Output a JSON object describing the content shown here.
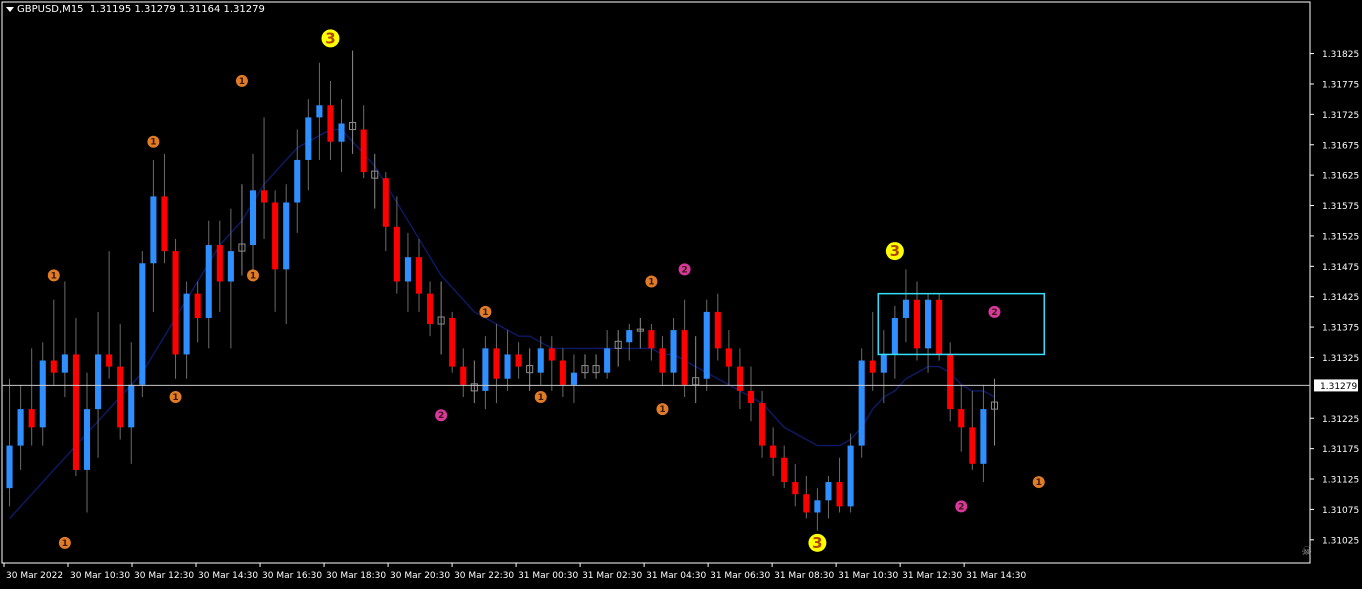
{
  "header": {
    "symbol": "GBPUSD,M15",
    "ohlc": "1.31195 1.31279 1.31164 1.31279"
  },
  "colors": {
    "background": "#000000",
    "bull": "#2f8fff",
    "bear": "#ff0000",
    "doji": "#8c8c8c",
    "ma": "#0d1a66",
    "box": "#33e0ff",
    "wave3": "#ffff00",
    "wave1": "#e07b28",
    "wave2": "#d9379e",
    "axis": "#ffffff",
    "priceline": "#c9c9c9"
  },
  "chart_data": {
    "type": "candlestick",
    "symbol": "GBPUSD",
    "timeframe": "M15",
    "ylim": [
      1.31,
      1.319
    ],
    "y_ticks": [
      "1.31825",
      "1.31775",
      "1.31725",
      "1.31675",
      "1.31625",
      "1.31575",
      "1.31525",
      "1.31475",
      "1.31425",
      "1.31375",
      "1.31325",
      "1.31279",
      "1.31225",
      "1.31175",
      "1.31125",
      "1.31075",
      "1.31025"
    ],
    "x_ticks": [
      "30 Mar 2022",
      "30 Mar 10:30",
      "30 Mar 12:30",
      "30 Mar 14:30",
      "30 Mar 16:30",
      "30 Mar 18:30",
      "30 Mar 20:30",
      "30 Mar 22:30",
      "31 Mar 00:30",
      "31 Mar 02:30",
      "31 Mar 04:30",
      "31 Mar 06:30",
      "31 Mar 08:30",
      "31 Mar 10:30",
      "31 Mar 12:30",
      "31 Mar 14:30"
    ],
    "last_price": "1.31279",
    "candles": [
      [
        1.3111,
        1.3129,
        1.3108,
        1.3118
      ],
      [
        1.3118,
        1.3128,
        1.3114,
        1.3124
      ],
      [
        1.3124,
        1.3134,
        1.3118,
        1.3121
      ],
      [
        1.3121,
        1.3135,
        1.3118,
        1.3132
      ],
      [
        1.3132,
        1.3142,
        1.3128,
        1.313
      ],
      [
        1.313,
        1.3145,
        1.3126,
        1.3133
      ],
      [
        1.3133,
        1.3139,
        1.3113,
        1.3114
      ],
      [
        1.3114,
        1.313,
        1.3107,
        1.3124
      ],
      [
        1.3124,
        1.314,
        1.3116,
        1.3133
      ],
      [
        1.3133,
        1.315,
        1.3129,
        1.3131
      ],
      [
        1.3131,
        1.3138,
        1.3119,
        1.3121
      ],
      [
        1.3121,
        1.3135,
        1.3115,
        1.3128
      ],
      [
        1.3128,
        1.315,
        1.3126,
        1.3148
      ],
      [
        1.3148,
        1.3165,
        1.314,
        1.3159
      ],
      [
        1.3159,
        1.3166,
        1.3148,
        1.315
      ],
      [
        1.315,
        1.3152,
        1.3129,
        1.3133
      ],
      [
        1.3133,
        1.3145,
        1.3129,
        1.3143
      ],
      [
        1.3143,
        1.3145,
        1.3135,
        1.3139
      ],
      [
        1.3139,
        1.3155,
        1.3134,
        1.3151
      ],
      [
        1.3151,
        1.3155,
        1.314,
        1.3145
      ],
      [
        1.3145,
        1.3157,
        1.3134,
        1.315
      ],
      [
        1.315,
        1.3161,
        1.3146,
        1.3151
      ],
      [
        1.3151,
        1.3166,
        1.3145,
        1.316
      ],
      [
        1.316,
        1.3172,
        1.3152,
        1.3158
      ],
      [
        1.3158,
        1.316,
        1.314,
        1.3147
      ],
      [
        1.3147,
        1.3161,
        1.3138,
        1.3158
      ],
      [
        1.3158,
        1.317,
        1.3153,
        1.3165
      ],
      [
        1.3165,
        1.3175,
        1.316,
        1.3172
      ],
      [
        1.3172,
        1.3181,
        1.3165,
        1.3174
      ],
      [
        1.3174,
        1.3178,
        1.3165,
        1.3168
      ],
      [
        1.3168,
        1.3175,
        1.3163,
        1.3171
      ],
      [
        1.3171,
        1.3183,
        1.3166,
        1.317
      ],
      [
        1.317,
        1.3174,
        1.3162,
        1.3163
      ],
      [
        1.3163,
        1.3166,
        1.3157,
        1.3162
      ],
      [
        1.3162,
        1.3163,
        1.315,
        1.3154
      ],
      [
        1.3154,
        1.3159,
        1.3143,
        1.3145
      ],
      [
        1.3145,
        1.3153,
        1.314,
        1.3149
      ],
      [
        1.3149,
        1.3152,
        1.314,
        1.3143
      ],
      [
        1.3143,
        1.3145,
        1.3136,
        1.3138
      ],
      [
        1.3138,
        1.3145,
        1.3133,
        1.3139
      ],
      [
        1.3139,
        1.314,
        1.313,
        1.3131
      ],
      [
        1.3131,
        1.3134,
        1.3126,
        1.3128
      ],
      [
        1.3128,
        1.3132,
        1.3125,
        1.3127
      ],
      [
        1.3127,
        1.3136,
        1.3124,
        1.3134
      ],
      [
        1.3134,
        1.3138,
        1.3125,
        1.3129
      ],
      [
        1.3129,
        1.3137,
        1.3127,
        1.3133
      ],
      [
        1.3133,
        1.3135,
        1.3129,
        1.3131
      ],
      [
        1.3131,
        1.3134,
        1.3127,
        1.313
      ],
      [
        1.313,
        1.3136,
        1.3128,
        1.3134
      ],
      [
        1.3134,
        1.3136,
        1.3127,
        1.3132
      ],
      [
        1.3132,
        1.3134,
        1.3126,
        1.3128
      ],
      [
        1.3128,
        1.3133,
        1.3125,
        1.313
      ],
      [
        1.313,
        1.3133,
        1.3129,
        1.3131
      ],
      [
        1.3131,
        1.3133,
        1.3129,
        1.313
      ],
      [
        1.313,
        1.3137,
        1.3129,
        1.3134
      ],
      [
        1.3134,
        1.3137,
        1.3131,
        1.3135
      ],
      [
        1.3135,
        1.3138,
        1.3132,
        1.3137
      ],
      [
        1.3137,
        1.3139,
        1.3134,
        1.3137
      ],
      [
        1.3137,
        1.3138,
        1.3132,
        1.3134
      ],
      [
        1.3134,
        1.3136,
        1.3128,
        1.313
      ],
      [
        1.313,
        1.3139,
        1.3128,
        1.3137
      ],
      [
        1.3137,
        1.3142,
        1.3126,
        1.3128
      ],
      [
        1.3128,
        1.3136,
        1.3125,
        1.3129
      ],
      [
        1.3129,
        1.3142,
        1.3127,
        1.314
      ],
      [
        1.314,
        1.3143,
        1.3132,
        1.3134
      ],
      [
        1.3134,
        1.3137,
        1.3128,
        1.3131
      ],
      [
        1.3131,
        1.3134,
        1.3124,
        1.3127
      ],
      [
        1.3127,
        1.3131,
        1.3122,
        1.3125
      ],
      [
        1.3125,
        1.3127,
        1.3116,
        1.3118
      ],
      [
        1.3118,
        1.3121,
        1.3113,
        1.3116
      ],
      [
        1.3116,
        1.3118,
        1.3111,
        1.3112
      ],
      [
        1.3112,
        1.3115,
        1.3108,
        1.311
      ],
      [
        1.311,
        1.3113,
        1.3106,
        1.3107
      ],
      [
        1.3107,
        1.3111,
        1.3104,
        1.3109
      ],
      [
        1.3109,
        1.3113,
        1.3106,
        1.3112
      ],
      [
        1.3112,
        1.3116,
        1.3107,
        1.3108
      ],
      [
        1.3108,
        1.312,
        1.3107,
        1.3118
      ],
      [
        1.3118,
        1.3134,
        1.3116,
        1.3132
      ],
      [
        1.3132,
        1.314,
        1.3127,
        1.313
      ],
      [
        1.313,
        1.3137,
        1.3125,
        1.3133
      ],
      [
        1.3133,
        1.3141,
        1.3129,
        1.3139
      ],
      [
        1.3139,
        1.3147,
        1.3135,
        1.3142
      ],
      [
        1.3142,
        1.3145,
        1.3132,
        1.3134
      ],
      [
        1.3134,
        1.3143,
        1.313,
        1.3142
      ],
      [
        1.3142,
        1.3143,
        1.3132,
        1.3133
      ],
      [
        1.3133,
        1.3135,
        1.3122,
        1.3124
      ],
      [
        1.3124,
        1.3128,
        1.3117,
        1.3121
      ],
      [
        1.3121,
        1.3127,
        1.3114,
        1.3115
      ],
      [
        1.3115,
        1.3128,
        1.3112,
        1.3124
      ],
      [
        1.3124,
        1.3129,
        1.3118,
        1.3125
      ]
    ],
    "ma": [
      1.3106,
      1.3108,
      1.311,
      1.3112,
      1.3114,
      1.3116,
      1.3118,
      1.312,
      1.3122,
      1.3124,
      1.3126,
      1.3128,
      1.313,
      1.3133,
      1.3136,
      1.3139,
      1.3142,
      1.3145,
      1.3148,
      1.3151,
      1.3153,
      1.3155,
      1.3158,
      1.3161,
      1.3163,
      1.3165,
      1.3167,
      1.3168,
      1.3169,
      1.317,
      1.317,
      1.3168,
      1.3166,
      1.3164,
      1.3161,
      1.3158,
      1.3155,
      1.3152,
      1.3149,
      1.3146,
      1.3144,
      1.3142,
      1.314,
      1.3139,
      1.3138,
      1.3137,
      1.3136,
      1.3136,
      1.3135,
      1.3134,
      1.3134,
      1.3134,
      1.3134,
      1.3134,
      1.3134,
      1.3134,
      1.3134,
      1.3134,
      1.3134,
      1.3133,
      1.3133,
      1.3132,
      1.3131,
      1.313,
      1.3129,
      1.3128,
      1.3127,
      1.3126,
      1.3125,
      1.3123,
      1.3121,
      1.312,
      1.3119,
      1.3118,
      1.3118,
      1.3118,
      1.3119,
      1.3121,
      1.3124,
      1.3126,
      1.3127,
      1.3129,
      1.313,
      1.3131,
      1.3131,
      1.313,
      1.3128,
      1.3127,
      1.3127,
      1.3126
    ],
    "box": {
      "start_index": 79,
      "end_index": 93,
      "high": 1.3143,
      "low": 1.3133
    },
    "wave_labels": [
      {
        "index": 29,
        "label": "3",
        "kind": "wave3",
        "price": 1.3185
      },
      {
        "index": 73,
        "label": "3",
        "kind": "wave3",
        "price": 1.3102
      },
      {
        "index": 80,
        "label": "3",
        "kind": "wave3",
        "price": 1.315
      },
      {
        "index": 4,
        "label": "1",
        "kind": "wave1",
        "price": 1.3146
      },
      {
        "index": 5,
        "label": "1",
        "kind": "wave1",
        "price": 1.3102
      },
      {
        "index": 13,
        "label": "1",
        "kind": "wave1",
        "price": 1.3168
      },
      {
        "index": 15,
        "label": "1",
        "kind": "wave1",
        "price": 1.3126
      },
      {
        "index": 21,
        "label": "1",
        "kind": "wave1",
        "price": 1.3178
      },
      {
        "index": 22,
        "label": "1",
        "kind": "wave1",
        "price": 1.3146
      },
      {
        "index": 39,
        "label": "2",
        "kind": "wave2",
        "price": 1.3123
      },
      {
        "index": 43,
        "label": "1",
        "kind": "wave1",
        "price": 1.314
      },
      {
        "index": 48,
        "label": "1",
        "kind": "wave1",
        "price": 1.3126
      },
      {
        "index": 58,
        "label": "1",
        "kind": "wave1",
        "price": 1.3145
      },
      {
        "index": 59,
        "label": "1",
        "kind": "wave1",
        "price": 1.3124
      },
      {
        "index": 61,
        "label": "2",
        "kind": "wave2",
        "price": 1.3147
      },
      {
        "index": 86,
        "label": "2",
        "kind": "wave2",
        "price": 1.3108
      },
      {
        "index": 89,
        "label": "2",
        "kind": "wave2",
        "price": 1.314
      },
      {
        "index": 93,
        "label": "1",
        "kind": "wave1",
        "price": 1.3112
      }
    ]
  }
}
